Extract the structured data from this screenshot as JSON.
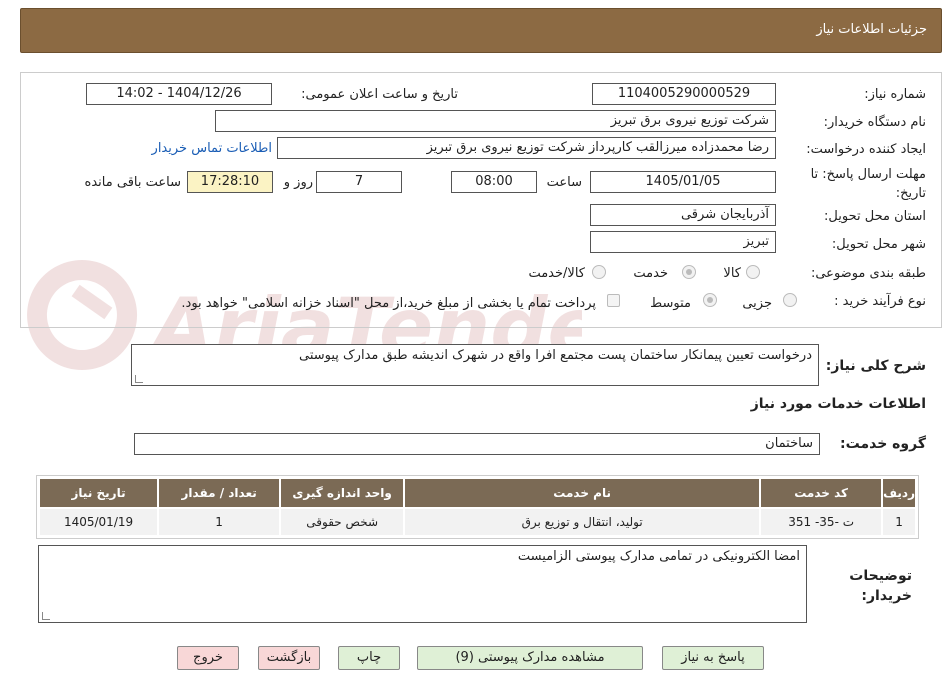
{
  "header": {
    "title": "جزئیات اطلاعات نیاز"
  },
  "form": {
    "need_number_label": "شماره نیاز:",
    "need_number": "1104005290000529",
    "announce_label": "تاریخ و ساعت اعلان عمومی:",
    "announce_value": "1404/12/26 - 14:02",
    "buyer_org_label": "نام دستگاه خریدار:",
    "buyer_org": "شرکت توزیع نیروی برق تبریز",
    "requester_label": "ایجاد کننده درخواست:",
    "requester": "رضا محمدزاده میرزالقب کارپرداز شرکت توزیع نیروی برق تبریز",
    "contact_link": "اطلاعات تماس خریدار",
    "deadline_label": "مهلت ارسال پاسخ: تا تاریخ:",
    "deadline_date": "1405/01/05",
    "time_label": "ساعت",
    "deadline_time": "08:00",
    "days_value": "7",
    "days_label": "روز و",
    "remaining_time": "17:28:10",
    "remaining_label": "ساعت باقی مانده",
    "province_label": "استان محل تحویل:",
    "province": "آذربایجان شرقی",
    "city_label": "شهر محل تحویل:",
    "city": "تبریز",
    "category_label": "طبقه بندی موضوعی:",
    "category_options": [
      "کالا",
      "خدمت",
      "کالا/خدمت"
    ],
    "category_selected": "خدمت",
    "process_label": "نوع فرآیند خرید :",
    "process_options": [
      "جزیی",
      "متوسط"
    ],
    "process_selected": "متوسط",
    "payment_note": "پرداخت تمام یا بخشی از مبلغ خرید،از محل \"اسناد خزانه اسلامی\" خواهد بود."
  },
  "summary": {
    "label": "شرح کلی نیاز:",
    "text": "درخواست تعیین پیمانکار ساختمان پست مجتمع افرا واقع در شهرک اندیشه طبق مدارک پیوستی"
  },
  "services": {
    "section_title": "اطلاعات خدمات مورد نیاز",
    "group_label": "گروه خدمت:",
    "group_value": "ساختمان",
    "columns": [
      "ردیف",
      "کد خدمت",
      "نام خدمت",
      "واحد اندازه گیری",
      "تعداد / مقدار",
      "تاریخ نیاز"
    ],
    "rows": [
      [
        "1",
        "ت -35- 351",
        "تولید، انتقال و توزیع برق",
        "شخص حقوقی",
        "1",
        "1405/01/19"
      ]
    ]
  },
  "buyer_notes": {
    "label": "توضیحات خریدار:",
    "text": "امضا الکترونیکی در تمامی مدارک پیوستی الزامیست"
  },
  "buttons": {
    "reply": "پاسخ به نیاز",
    "attachments": "مشاهده مدارک پیوستی (9)",
    "print": "چاپ",
    "back": "بازگشت",
    "exit": "خروج"
  },
  "watermark": {
    "text": "AriaTender.neT"
  },
  "colors": {
    "header": "#8c6a43",
    "table_header": "#7b6a55",
    "button_green": "#dff0d6",
    "button_pink": "#f8d7d7",
    "remaining_bg": "#fbf3c4",
    "link": "#1a5db5"
  }
}
